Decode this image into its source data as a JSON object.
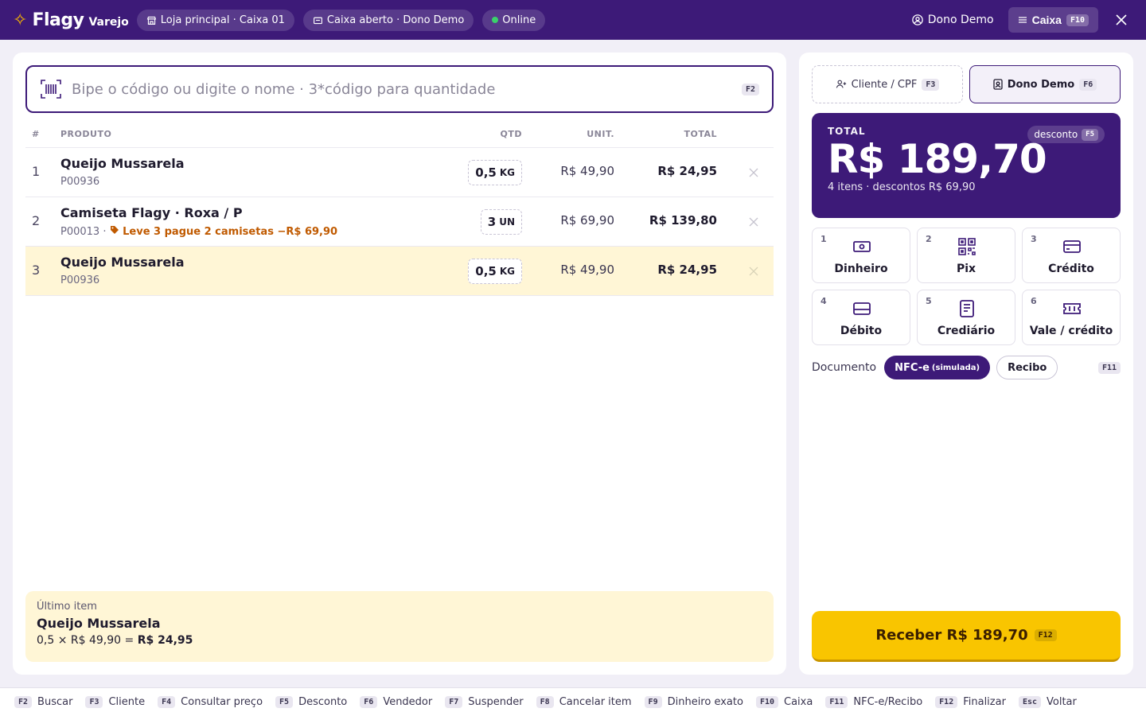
{
  "topbar": {
    "brand": "Flagy",
    "brand_sub": "Varejo",
    "store": "Loja principal · Caixa 01",
    "register_status": "Caixa aberto · Dono Demo",
    "connection": "Online",
    "user": "Dono Demo",
    "caixa_label": "Caixa",
    "caixa_key": "F10",
    "colors": {
      "primary": "#3d1a78",
      "accent": "#f7b500",
      "online": "#3ad26b"
    }
  },
  "search": {
    "placeholder": "Bipe o código ou digite o nome · 3*código para quantidade",
    "value": "",
    "key": "F2"
  },
  "table": {
    "headers": {
      "num": "#",
      "product": "PRODUTO",
      "qty": "QTD",
      "unit": "UNIT.",
      "total": "TOTAL"
    },
    "rows": [
      {
        "num": "1",
        "name": "Queijo Mussarela",
        "sku": "P00936",
        "promo": "",
        "qty": "0,5",
        "qty_unit": "KG",
        "unit": "R$ 49,90",
        "total": "R$ 24,95",
        "highlighted": false
      },
      {
        "num": "2",
        "name": "Camiseta Flagy · Roxa / P",
        "sku": "P00013 ·",
        "promo": "Leve 3 pague 2 camisetas −R$ 69,90",
        "qty": "3",
        "qty_unit": "UN",
        "unit": "R$ 69,90",
        "total": "R$ 139,80",
        "highlighted": false
      },
      {
        "num": "3",
        "name": "Queijo Mussarela",
        "sku": "P00936",
        "promo": "",
        "qty": "0,5",
        "qty_unit": "KG",
        "unit": "R$ 49,90",
        "total": "R$ 24,95",
        "highlighted": true
      }
    ]
  },
  "last_item": {
    "label": "Último item",
    "name": "Queijo Mussarela",
    "calc_prefix": "0,5 × R$ 49,90 =",
    "calc_total": "R$ 24,95"
  },
  "side": {
    "client_label": "Cliente / CPF",
    "client_key": "F3",
    "seller_label": "Dono Demo",
    "seller_key": "F6",
    "total_label": "TOTAL",
    "total_value": "R$ 189,70",
    "total_info": "4 itens · descontos R$ 69,90",
    "discount_label": "desconto",
    "discount_key": "F5",
    "payments": [
      {
        "num": "1",
        "label": "Dinheiro",
        "icon": "cash-icon"
      },
      {
        "num": "2",
        "label": "Pix",
        "icon": "qr-code-icon"
      },
      {
        "num": "3",
        "label": "Crédito",
        "icon": "credit-card-icon"
      },
      {
        "num": "4",
        "label": "Débito",
        "icon": "debit-card-icon"
      },
      {
        "num": "5",
        "label": "Crediário",
        "icon": "ledger-icon"
      },
      {
        "num": "6",
        "label": "Vale / crédito",
        "icon": "voucher-icon"
      }
    ],
    "document_label": "Documento",
    "doc_nfce": "NFC-e",
    "doc_nfce_note": "(simulada)",
    "doc_receipt": "Recibo",
    "doc_key": "F11",
    "receive_label": "Receber R$ 189,70",
    "receive_key": "F12"
  },
  "footer": {
    "shortcuts": [
      {
        "key": "F2",
        "label": "Buscar"
      },
      {
        "key": "F3",
        "label": "Cliente"
      },
      {
        "key": "F4",
        "label": "Consultar preço"
      },
      {
        "key": "F5",
        "label": "Desconto"
      },
      {
        "key": "F6",
        "label": "Vendedor"
      },
      {
        "key": "F7",
        "label": "Suspender"
      },
      {
        "key": "F8",
        "label": "Cancelar item"
      },
      {
        "key": "F9",
        "label": "Dinheiro exato"
      },
      {
        "key": "F10",
        "label": "Caixa"
      },
      {
        "key": "F11",
        "label": "NFC-e/Recibo"
      },
      {
        "key": "F12",
        "label": "Finalizar"
      },
      {
        "key": "Esc",
        "label": "Voltar"
      }
    ]
  }
}
